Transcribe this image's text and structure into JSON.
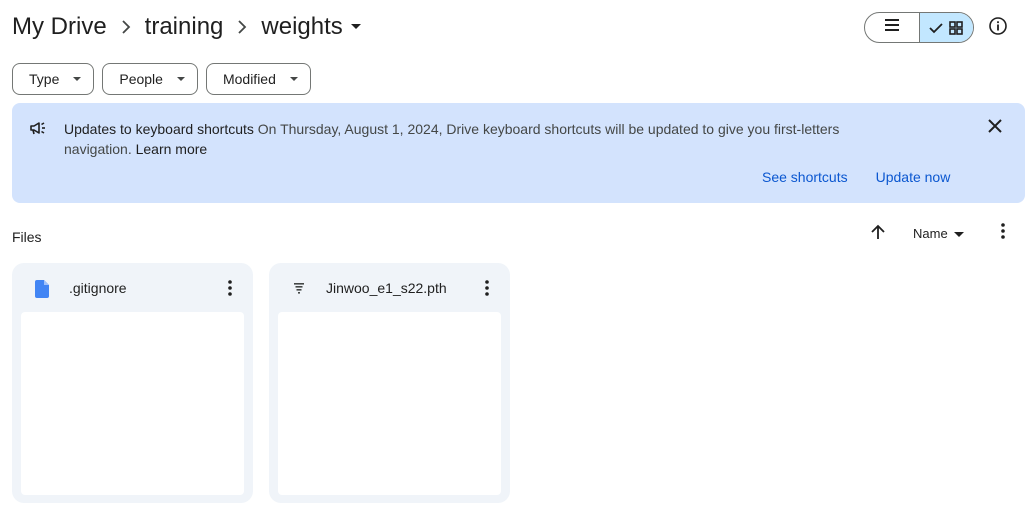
{
  "breadcrumb": {
    "items": [
      {
        "label": "My Drive"
      },
      {
        "label": "training"
      }
    ],
    "current": "weights"
  },
  "view_toggle": {
    "list_icon": "list-icon",
    "grid_icon": "grid-icon",
    "active": "grid"
  },
  "info_icon": "info-icon",
  "filters": [
    {
      "label": "Type"
    },
    {
      "label": "People"
    },
    {
      "label": "Modified"
    }
  ],
  "banner": {
    "icon": "megaphone-icon",
    "title": "Updates to keyboard shortcuts",
    "body": " On Thursday, August 1, 2024, Drive keyboard shortcuts will be updated to give you first-letters navigation. ",
    "learn_more": "Learn more",
    "see_shortcuts": "See shortcuts",
    "update_now": "Update now",
    "accent": "#0b57d0",
    "background": "#d3e3fd"
  },
  "files_section": {
    "label": "Files",
    "sort_label": "Name",
    "sort_direction": "ascending"
  },
  "files": [
    {
      "name": ".gitignore",
      "icon": "doc-icon",
      "icon_color": "#4285f4"
    },
    {
      "name": "Jinwoo_e1_s22.pth",
      "icon": "binary-file-icon",
      "icon_color": "#444746"
    }
  ]
}
